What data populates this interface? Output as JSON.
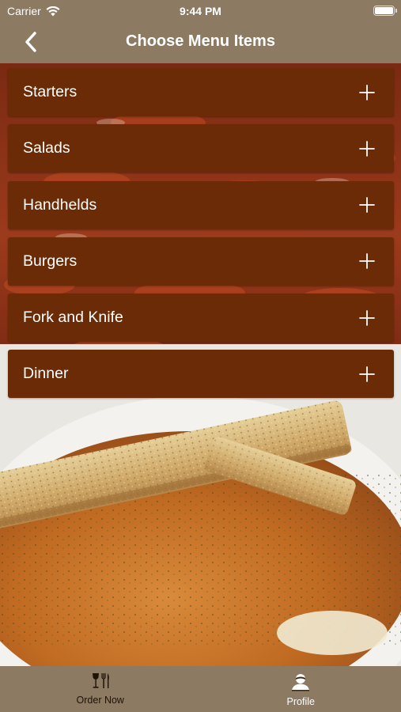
{
  "status_bar": {
    "carrier": "Carrier",
    "time": "9:44 PM"
  },
  "nav": {
    "title": "Choose Menu Items",
    "back_icon": "chevron-left-icon"
  },
  "menu": {
    "items": [
      {
        "label": "Starters"
      },
      {
        "label": "Salads"
      },
      {
        "label": "Handhelds"
      },
      {
        "label": "Burgers"
      },
      {
        "label": "Fork and Knife"
      },
      {
        "label": "Dinner"
      }
    ],
    "expand_icon": "plus-icon"
  },
  "tab_bar": {
    "tabs": [
      {
        "label": "Order Now",
        "icon": "fork-knife-wine-icon",
        "selected": false
      },
      {
        "label": "Profile",
        "icon": "person-icon",
        "selected": true
      }
    ]
  },
  "colors": {
    "header_bg": "#8c7a62",
    "menu_item_bg": "#6a2b06",
    "text": "#ffffff"
  }
}
